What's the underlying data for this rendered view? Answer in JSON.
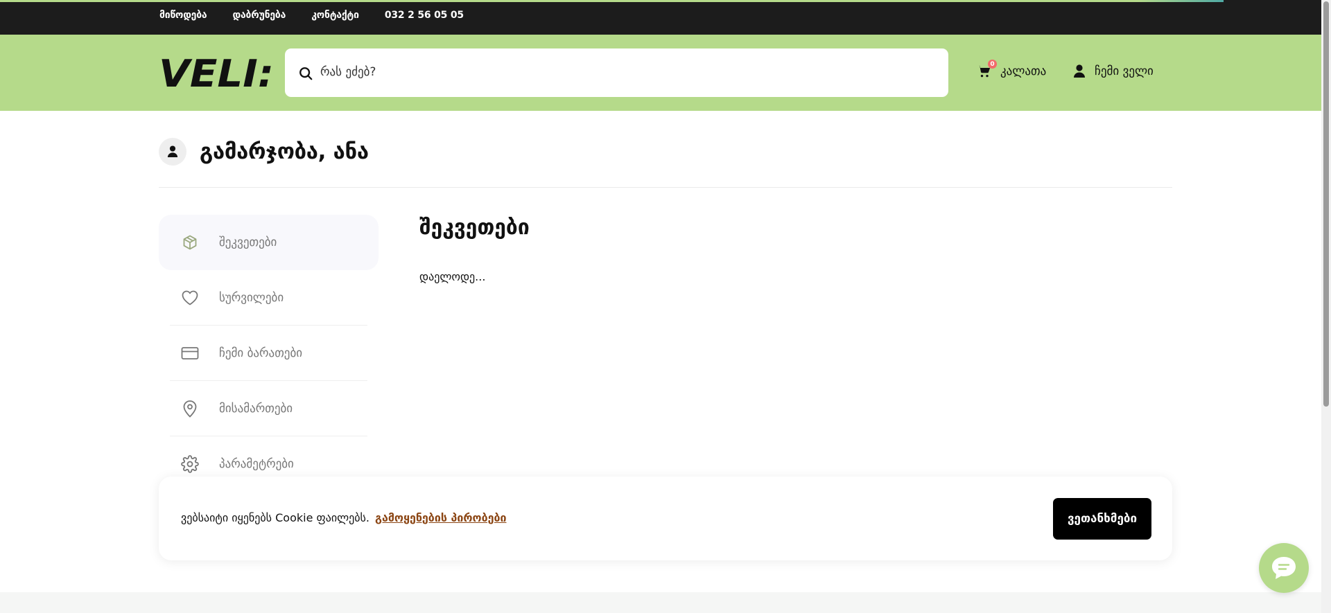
{
  "topbar": {
    "links": [
      "მიწოდება",
      "დაბრუნება",
      "კონტაქტი",
      "032 2 56 05 05"
    ]
  },
  "header": {
    "logo_text": "VELI:",
    "search_placeholder": "რას ეძებ?",
    "cart_label": "კალათა",
    "cart_count": "0",
    "account_label": "ჩემი ველი"
  },
  "profile": {
    "greeting": "გამარჯობა, ანა"
  },
  "sidebar": {
    "items": [
      {
        "label": "შეკვეთები",
        "icon": "box-icon",
        "active": true
      },
      {
        "label": "სურვილები",
        "icon": "heart-icon",
        "active": false
      },
      {
        "label": "ჩემი ბარათები",
        "icon": "credit-card-icon",
        "active": false
      },
      {
        "label": "მისამართები",
        "icon": "map-pin-icon",
        "active": false
      },
      {
        "label": "პარამეტრები",
        "icon": "gear-icon",
        "active": false
      }
    ]
  },
  "main": {
    "title": "შეკვეთები",
    "status": "დაელოდე..."
  },
  "cookie": {
    "message": "ვებსაიტი იყენებს Cookie ფაილებს.",
    "link": "გამოყენების პირობები",
    "accept": "ვეთანხმები"
  },
  "colors": {
    "brand_green": "#b5da8a",
    "topbar_dark": "#1c1c1c",
    "badge_red": "#f26a6a",
    "cookie_link": "#8b4513"
  }
}
